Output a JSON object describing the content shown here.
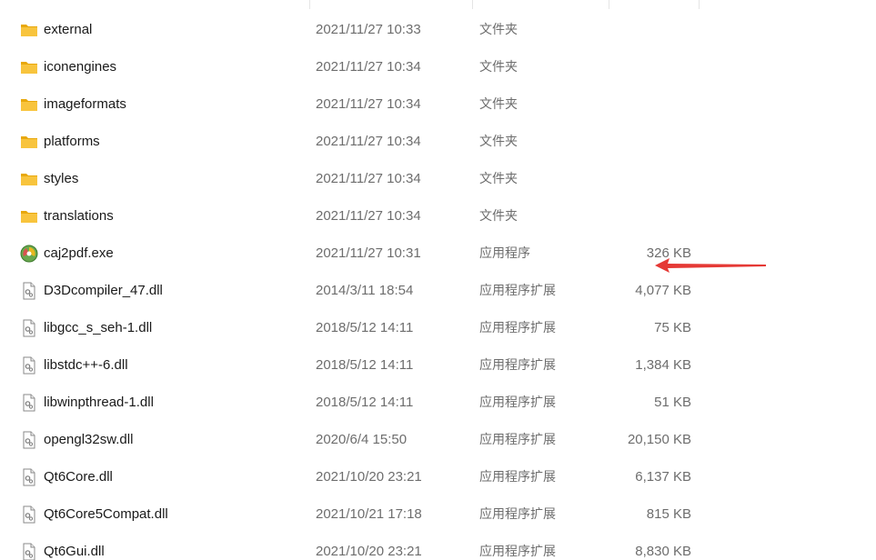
{
  "files": [
    {
      "name": "external",
      "date": "2021/11/27 10:33",
      "type": "文件夹",
      "size": "",
      "icon": "folder-icon"
    },
    {
      "name": "iconengines",
      "date": "2021/11/27 10:34",
      "type": "文件夹",
      "size": "",
      "icon": "folder-icon"
    },
    {
      "name": "imageformats",
      "date": "2021/11/27 10:34",
      "type": "文件夹",
      "size": "",
      "icon": "folder-icon"
    },
    {
      "name": "platforms",
      "date": "2021/11/27 10:34",
      "type": "文件夹",
      "size": "",
      "icon": "folder-icon"
    },
    {
      "name": "styles",
      "date": "2021/11/27 10:34",
      "type": "文件夹",
      "size": "",
      "icon": "folder-icon"
    },
    {
      "name": "translations",
      "date": "2021/11/27 10:34",
      "type": "文件夹",
      "size": "",
      "icon": "folder-icon"
    },
    {
      "name": "caj2pdf.exe",
      "date": "2021/11/27 10:31",
      "type": "应用程序",
      "size": "326 KB",
      "icon": "exe-app-icon"
    },
    {
      "name": "D3Dcompiler_47.dll",
      "date": "2014/3/11 18:54",
      "type": "应用程序扩展",
      "size": "4,077 KB",
      "icon": "dll-file-icon"
    },
    {
      "name": "libgcc_s_seh-1.dll",
      "date": "2018/5/12 14:11",
      "type": "应用程序扩展",
      "size": "75 KB",
      "icon": "dll-file-icon"
    },
    {
      "name": "libstdc++-6.dll",
      "date": "2018/5/12 14:11",
      "type": "应用程序扩展",
      "size": "1,384 KB",
      "icon": "dll-file-icon"
    },
    {
      "name": "libwinpthread-1.dll",
      "date": "2018/5/12 14:11",
      "type": "应用程序扩展",
      "size": "51 KB",
      "icon": "dll-file-icon"
    },
    {
      "name": "opengl32sw.dll",
      "date": "2020/6/4 15:50",
      "type": "应用程序扩展",
      "size": "20,150 KB",
      "icon": "dll-file-icon"
    },
    {
      "name": "Qt6Core.dll",
      "date": "2021/10/20 23:21",
      "type": "应用程序扩展",
      "size": "6,137 KB",
      "icon": "dll-file-icon"
    },
    {
      "name": "Qt6Core5Compat.dll",
      "date": "2021/10/21 17:18",
      "type": "应用程序扩展",
      "size": "815 KB",
      "icon": "dll-file-icon"
    },
    {
      "name": "Qt6Gui.dll",
      "date": "2021/10/20 23:21",
      "type": "应用程序扩展",
      "size": "8,830 KB",
      "icon": "dll-file-icon"
    }
  ],
  "annotation": {
    "icon": "red-arrow-icon",
    "color": "#e53935"
  },
  "colors": {
    "folder": "#f8c43d",
    "folder_dark": "#e8a80c",
    "text_secondary": "#6d6d6d"
  }
}
